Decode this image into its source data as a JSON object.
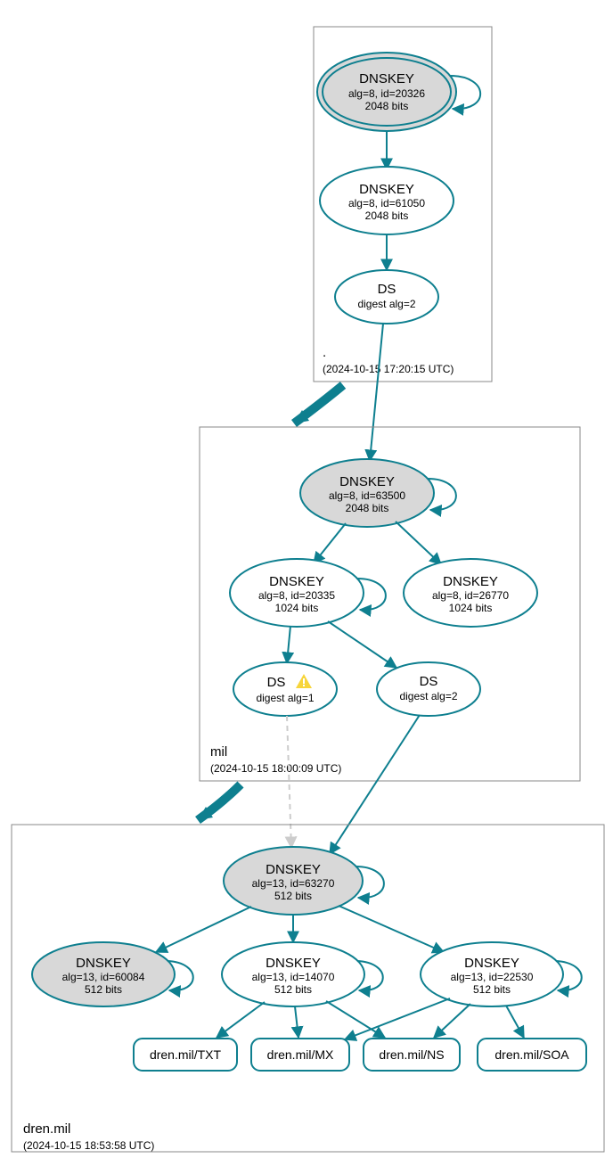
{
  "colors": {
    "teal": "#0e7f8f",
    "nodeFill": "#d8d8d8",
    "box": "#888888"
  },
  "zones": {
    "root": {
      "label": ".",
      "timestamp": "(2024-10-15 17:20:15 UTC)"
    },
    "mil": {
      "label": "mil",
      "timestamp": "(2024-10-15 18:00:09 UTC)"
    },
    "dren": {
      "label": "dren.mil",
      "timestamp": "(2024-10-15 18:53:58 UTC)"
    }
  },
  "nodes": {
    "root_ksk": {
      "title": "DNSKEY",
      "l1": "alg=8, id=20326",
      "l2": "2048 bits"
    },
    "root_zsk": {
      "title": "DNSKEY",
      "l1": "alg=8, id=61050",
      "l2": "2048 bits"
    },
    "root_ds": {
      "title": "DS",
      "l1": "digest alg=2"
    },
    "mil_ksk": {
      "title": "DNSKEY",
      "l1": "alg=8, id=63500",
      "l2": "2048 bits"
    },
    "mil_zsk1": {
      "title": "DNSKEY",
      "l1": "alg=8, id=20335",
      "l2": "1024 bits"
    },
    "mil_zsk2": {
      "title": "DNSKEY",
      "l1": "alg=8, id=26770",
      "l2": "1024 bits"
    },
    "mil_ds1": {
      "title": "DS",
      "l1": "digest alg=1",
      "warn": true
    },
    "mil_ds2": {
      "title": "DS",
      "l1": "digest alg=2"
    },
    "dren_ksk": {
      "title": "DNSKEY",
      "l1": "alg=13, id=63270",
      "l2": "512 bits"
    },
    "dren_k1": {
      "title": "DNSKEY",
      "l1": "alg=13, id=60084",
      "l2": "512 bits"
    },
    "dren_k2": {
      "title": "DNSKEY",
      "l1": "alg=13, id=14070",
      "l2": "512 bits"
    },
    "dren_k3": {
      "title": "DNSKEY",
      "l1": "alg=13, id=22530",
      "l2": "512 bits"
    },
    "rr_txt": {
      "label": "dren.mil/TXT"
    },
    "rr_mx": {
      "label": "dren.mil/MX"
    },
    "rr_ns": {
      "label": "dren.mil/NS"
    },
    "rr_soa": {
      "label": "dren.mil/SOA"
    }
  }
}
